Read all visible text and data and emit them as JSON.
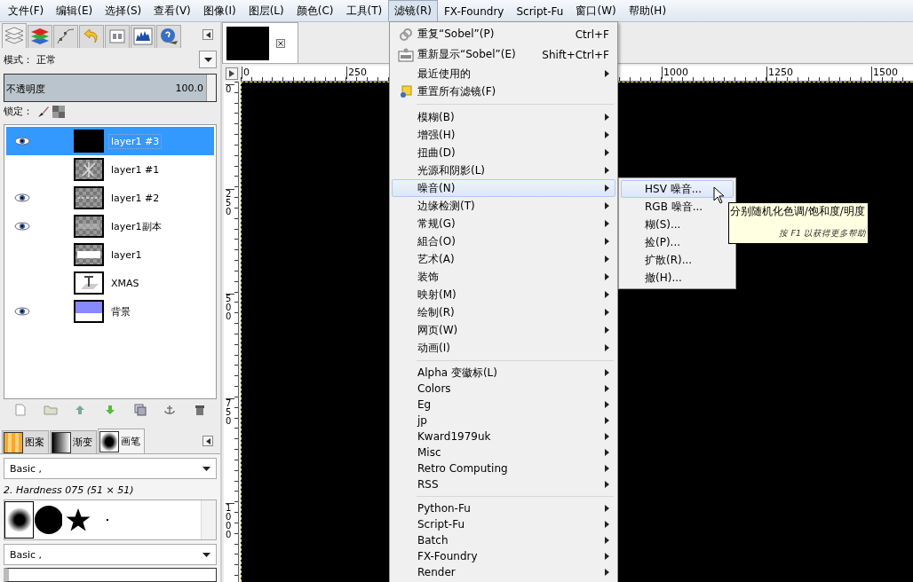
{
  "menubar": [
    {
      "label": "文件(F)",
      "selected": false
    },
    {
      "label": "编辑(E)",
      "selected": false
    },
    {
      "label": "选择(S)",
      "selected": false
    },
    {
      "label": "查看(V)",
      "selected": false
    },
    {
      "label": "图像(I)",
      "selected": false
    },
    {
      "label": "图层(L)",
      "selected": false
    },
    {
      "label": "颜色(C)",
      "selected": false
    },
    {
      "label": "工具(T)",
      "selected": false
    },
    {
      "label": "滤镜(R)",
      "selected": true
    },
    {
      "label": "FX-Foundry",
      "selected": false
    },
    {
      "label": "Script-Fu",
      "selected": false
    },
    {
      "label": "窗口(W)",
      "selected": false
    },
    {
      "label": "帮助(H)",
      "selected": false
    }
  ],
  "layers_panel": {
    "dock_tabs": [
      {
        "kind": "layers",
        "selected": true
      },
      {
        "kind": "channels",
        "selected": false
      },
      {
        "kind": "paths",
        "selected": false
      },
      {
        "kind": "undo",
        "selected": false
      },
      {
        "kind": "pointer",
        "selected": false
      },
      {
        "kind": "histogram",
        "selected": false
      },
      {
        "kind": "help",
        "selected": false
      }
    ],
    "mode_label": "模式：",
    "mode_value": "正常",
    "opacity": {
      "label": "不透明度",
      "value": "100.0",
      "level": 1.0
    },
    "lock_label": "锁定：",
    "layers": [
      {
        "name": "layer1 #3",
        "visible": true,
        "selected": true,
        "kind": "black"
      },
      {
        "name": "layer1 #1",
        "visible": false,
        "selected": false,
        "kind": "sparkle"
      },
      {
        "name": "layer1 #2",
        "visible": true,
        "selected": false,
        "kind": "dashes"
      },
      {
        "name": "layer1副本",
        "visible": true,
        "selected": false,
        "kind": "faded"
      },
      {
        "name": "layer1",
        "visible": false,
        "selected": false,
        "kind": "bold"
      },
      {
        "name": "XMAS",
        "visible": false,
        "selected": false,
        "kind": "text"
      },
      {
        "name": "背景",
        "visible": true,
        "selected": false,
        "kind": "gradient"
      }
    ]
  },
  "brushes_panel": {
    "tabs": [
      {
        "label": "图案",
        "kind": "pattern",
        "selected": false
      },
      {
        "label": "渐变",
        "kind": "gradient",
        "selected": false
      },
      {
        "label": "画笔",
        "kind": "brush",
        "selected": true
      }
    ],
    "tag_filter": "Basic ,",
    "brush_name": "2. Hardness 075 (51 × 51)",
    "brushes": [
      {
        "kind": "soft",
        "selected": true
      },
      {
        "kind": "hard",
        "selected": false
      },
      {
        "kind": "star",
        "selected": false
      },
      {
        "kind": "dot",
        "selected": false
      }
    ],
    "tag_entry": "Basic ,"
  },
  "canvas": {
    "top_ruler": [
      "0",
      "250",
      "1000",
      "1250",
      "1500"
    ],
    "left_ruler": [
      "0",
      "250",
      "500",
      "750",
      "1000"
    ]
  },
  "filters_menu": [
    {
      "kind": "item",
      "label": "重复“Sobel”(P)",
      "shortcut": "Ctrl+F",
      "submenu": false,
      "selected": false
    },
    {
      "kind": "item",
      "label": "重新显示“Sobel”(E)",
      "shortcut": "Shift+Ctrl+F",
      "submenu": false,
      "selected": false
    },
    {
      "kind": "item",
      "label": "最近使用的",
      "submenu": true,
      "selected": false
    },
    {
      "kind": "item",
      "label": "重置所有滤镜(F)",
      "submenu": false,
      "selected": false
    },
    {
      "kind": "separator"
    },
    {
      "kind": "item",
      "label": "模糊(B)",
      "submenu": true,
      "selected": false
    },
    {
      "kind": "item",
      "label": "增强(H)",
      "submenu": true,
      "selected": false
    },
    {
      "kind": "item",
      "label": "扭曲(D)",
      "submenu": true,
      "selected": false
    },
    {
      "kind": "item",
      "label": "光源和阴影(L)",
      "submenu": true,
      "selected": false
    },
    {
      "kind": "item",
      "label": "噪音(N)",
      "submenu": true,
      "selected": true
    },
    {
      "kind": "item",
      "label": "边缘检测(T)",
      "submenu": true,
      "selected": false
    },
    {
      "kind": "item",
      "label": "常规(G)",
      "submenu": true,
      "selected": false
    },
    {
      "kind": "item",
      "label": "組合(O)",
      "submenu": true,
      "selected": false
    },
    {
      "kind": "item",
      "label": "艺术(A)",
      "submenu": true,
      "selected": false
    },
    {
      "kind": "item",
      "label": "装饰",
      "submenu": true,
      "selected": false
    },
    {
      "kind": "item",
      "label": "映射(M)",
      "submenu": true,
      "selected": false
    },
    {
      "kind": "item",
      "label": "绘制(R)",
      "submenu": true,
      "selected": false
    },
    {
      "kind": "item",
      "label": "网页(W)",
      "submenu": true,
      "selected": false
    },
    {
      "kind": "item",
      "label": "动画(I)",
      "submenu": true,
      "selected": false
    },
    {
      "kind": "separator"
    },
    {
      "kind": "small",
      "label": "Alpha 变徽标(L)",
      "submenu": true,
      "selected": false
    },
    {
      "kind": "small",
      "label": "Colors",
      "submenu": true,
      "selected": false
    },
    {
      "kind": "small",
      "label": "Eg",
      "submenu": true,
      "selected": false
    },
    {
      "kind": "small",
      "label": "jp",
      "submenu": true,
      "selected": false
    },
    {
      "kind": "small",
      "label": "Kward1979uk",
      "submenu": true,
      "selected": false
    },
    {
      "kind": "small",
      "label": "Misc",
      "submenu": true,
      "selected": false
    },
    {
      "kind": "small",
      "label": "Retro Computing",
      "submenu": true,
      "selected": false
    },
    {
      "kind": "small",
      "label": "RSS",
      "submenu": true,
      "selected": false
    },
    {
      "kind": "separator"
    },
    {
      "kind": "small",
      "label": "Python-Fu",
      "submenu": true,
      "selected": false
    },
    {
      "kind": "small",
      "label": "Script-Fu",
      "submenu": true,
      "selected": false
    },
    {
      "kind": "small",
      "label": "Batch",
      "submenu": true,
      "selected": false
    },
    {
      "kind": "small",
      "label": "FX-Foundry",
      "submenu": true,
      "selected": false
    },
    {
      "kind": "small",
      "label": "Render",
      "submenu": true,
      "selected": false
    }
  ],
  "noise_submenu": [
    {
      "label": "HSV 噪音...",
      "selected": true
    },
    {
      "label": "RGB 噪音...",
      "selected": false
    },
    {
      "label": "糊(S)...",
      "selected": false
    },
    {
      "label": "捡(P)...",
      "selected": false
    },
    {
      "label": "扩散(R)...",
      "selected": false
    },
    {
      "label": "撤(H)...",
      "selected": false
    }
  ],
  "tooltip": {
    "text": "分别随机化色调/饱和度/明度",
    "hint": "按 F1 以获得更多帮助"
  }
}
